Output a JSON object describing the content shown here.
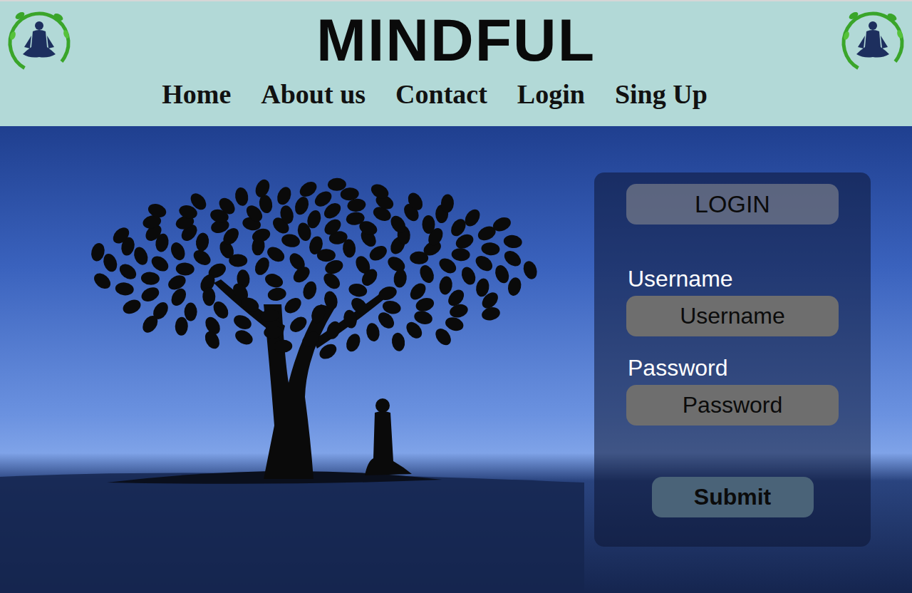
{
  "header": {
    "title": "MINDFUL"
  },
  "nav": {
    "items": [
      {
        "label": "Home"
      },
      {
        "label": "About us"
      },
      {
        "label": "Contact"
      },
      {
        "label": "Login"
      },
      {
        "label": "Sing Up"
      }
    ]
  },
  "login": {
    "title": "LOGIN",
    "fields": [
      {
        "label": "Username",
        "placeholder": "Username",
        "kind": "text"
      },
      {
        "label": "Password",
        "placeholder": "Password",
        "kind": "password"
      }
    ],
    "submit": "Submit"
  }
}
